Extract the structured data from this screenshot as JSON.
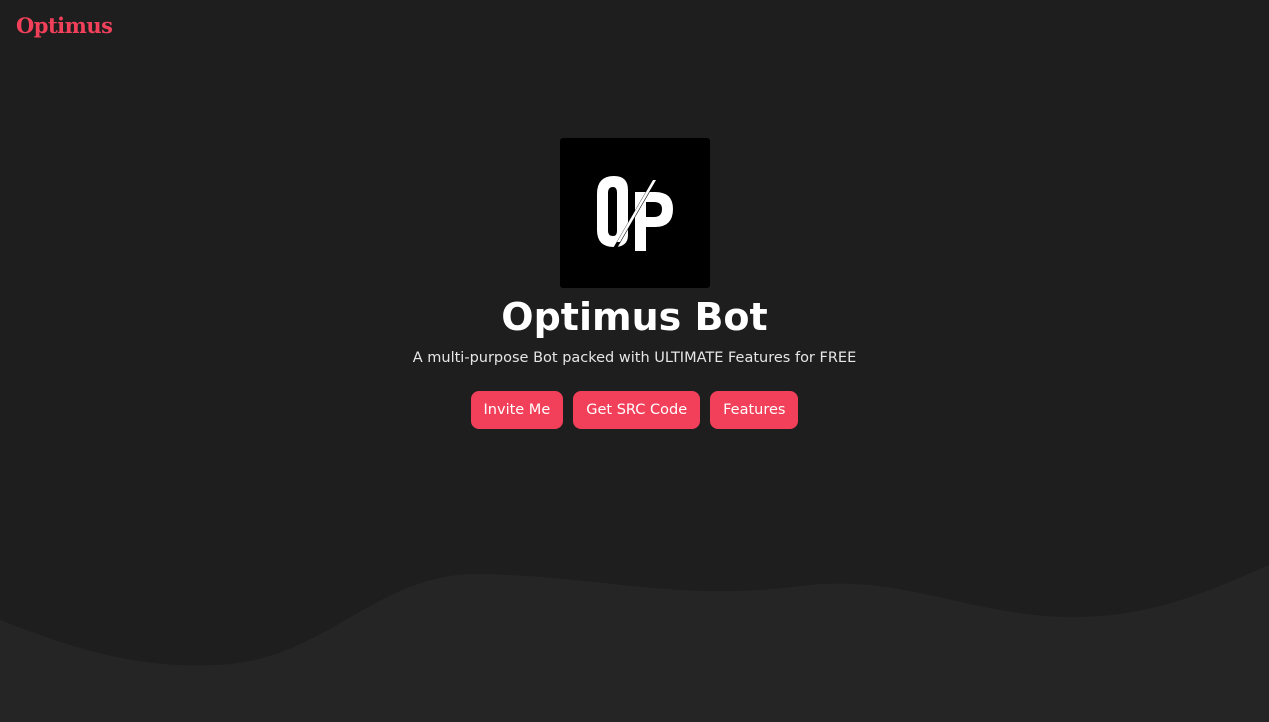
{
  "header": {
    "brand": "Optimus"
  },
  "hero": {
    "logo": {
      "icon": "op-logo-icon",
      "letters": "OP"
    },
    "title": "Optimus Bot",
    "subtitle": "A multi-purpose Bot packed with ULTIMATE Features for FREE"
  },
  "buttons": {
    "invite_label": "Invite Me",
    "src_label": "Get SRC Code",
    "features_label": "Features"
  },
  "colors": {
    "accent": "#f2405a",
    "background": "#1e1e1e",
    "wave": "#252525",
    "logo_bg": "#000000"
  }
}
